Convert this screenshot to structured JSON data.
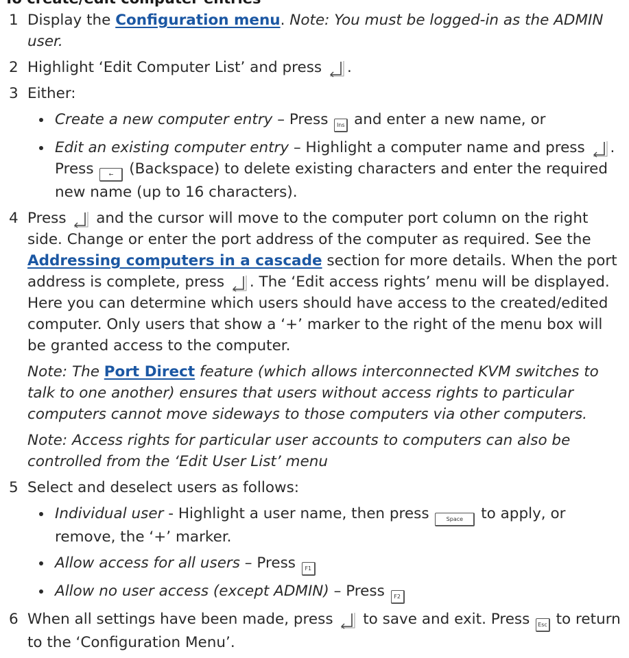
{
  "heading": "To create/edit computer entries",
  "keys": {
    "ins": "Ins",
    "space": "Space",
    "f1": "F1",
    "f2": "F2",
    "esc": "Esc",
    "backspace_arrow": "←"
  },
  "steps": {
    "s1": {
      "num": "1",
      "pre": "Display the ",
      "link": "Configuration menu",
      "post": ". ",
      "note": "Note: You must be logged-in as the ADMIN user."
    },
    "s2": {
      "num": "2",
      "pre": "Highlight ‘Edit Computer List’ and press ",
      "post": "."
    },
    "s3": {
      "num": "3",
      "text": "Either:",
      "b1": {
        "em": "Create a new computer entry",
        "pre": " – Press ",
        "post": " and enter a new name, or"
      },
      "b2": {
        "em": "Edit an existing computer entry",
        "pre": " – Highlight a computer name and press ",
        "mid": ". Press ",
        "post": " (Backspace) to delete existing characters and enter the required new name (up to 16 characters)."
      }
    },
    "s4": {
      "num": "4",
      "pre": "Press ",
      "mid1": " and the cursor will move to the computer port column on the right side. Change or enter the port address of the computer as required. See the ",
      "link": "Addressing computers in a cascade",
      "mid2": " section for more details. When the port address is complete, press ",
      "post": ". The ‘Edit access rights’ menu will be displayed. Here you can determine which users should have access to the created/edited computer. Only users that show a ‘+’ marker to the right of the menu box will be granted access to the computer.",
      "note1_pre": "Note: The ",
      "note1_link": "Port Direct",
      "note1_post": " feature (which allows interconnected KVM switches to talk to one another) ensures that users without access rights to particular computers cannot move sideways to those computers via other computers.",
      "note2": "Note: Access rights for particular user accounts to computers can also be controlled from the ‘Edit User List’ menu"
    },
    "s5": {
      "num": "5",
      "text": "Select and deselect users as follows:",
      "b1": {
        "em": "Individual user",
        "pre": " - Highlight a user name, then press ",
        "post": " to apply, or remove, the ‘+’ marker."
      },
      "b2": {
        "em": "Allow access for all users",
        "pre": " – Press "
      },
      "b3": {
        "em": "Allow no user access (except ADMIN)",
        "pre": " – Press "
      }
    },
    "s6": {
      "num": "6",
      "pre": "When all settings have been made, press ",
      "mid": " to save and exit. Press ",
      "post": " to return to the ‘Configuration Menu’."
    }
  }
}
